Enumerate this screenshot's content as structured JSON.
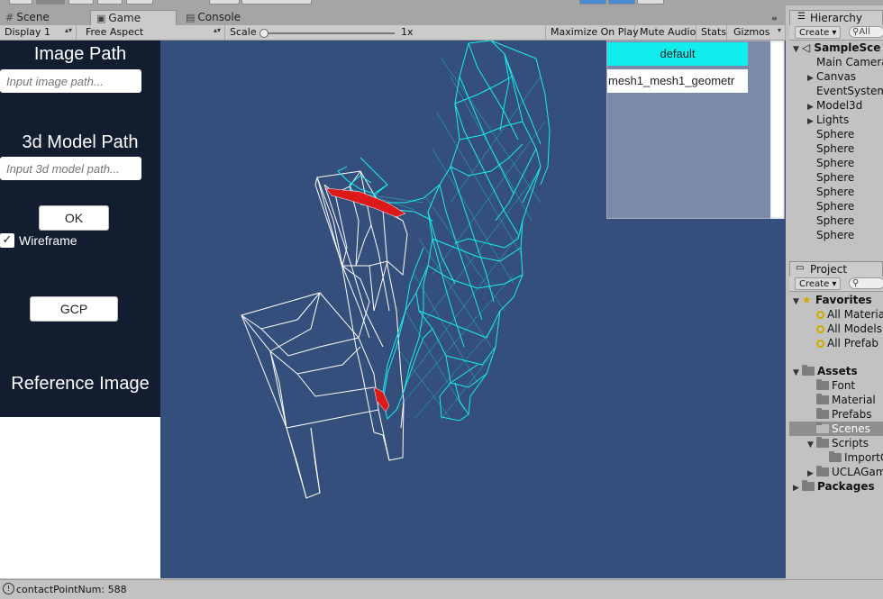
{
  "tabs": {
    "scene": "Scene",
    "game": "Game",
    "console": "Console"
  },
  "game_toolbar": {
    "display": "Display 1",
    "aspect": "Free Aspect",
    "scale_label": "Scale",
    "scale_value": "1x",
    "maximize": "Maximize On Play",
    "mute": "Mute Audio",
    "stats": "Stats",
    "gizmos": "Gizmos"
  },
  "game_ui": {
    "image_path_label": "Image Path",
    "image_path_placeholder": "Input image path...",
    "model_path_label": "3d Model Path",
    "model_path_placeholder": "Input 3d model path...",
    "ok_button": "OK",
    "wireframe_label": "Wireframe",
    "wireframe_checked": true,
    "gcp_button": "GCP",
    "reference_label": "Reference Image",
    "default_button": "default",
    "mesh_button": "mesh1_mesh1_geometr"
  },
  "hierarchy": {
    "title": "Hierarchy",
    "create": "Create",
    "search": "All",
    "scene_name": "SampleSce",
    "items": [
      "Main Camera",
      "Canvas",
      "EventSystem",
      "Model3d",
      "Lights",
      "Sphere",
      "Sphere",
      "Sphere",
      "Sphere",
      "Sphere",
      "Sphere",
      "Sphere",
      "Sphere"
    ]
  },
  "project": {
    "title": "Project",
    "create": "Create",
    "favorites": "Favorites",
    "fav_items": [
      "All Materia",
      "All Models",
      "All Prefab"
    ],
    "assets": "Assets",
    "asset_items": [
      "Font",
      "Material",
      "Prefabs",
      "Scenes",
      "Scripts",
      "ImportC",
      "UCLAGam"
    ],
    "packages": "Packages"
  },
  "status": {
    "message": "contactPointNum: 588"
  },
  "colors": {
    "game_bg": "#344f7b",
    "panel_dark": "#121d30",
    "cyan": "#11eded",
    "contact": "#dd1a1a"
  }
}
